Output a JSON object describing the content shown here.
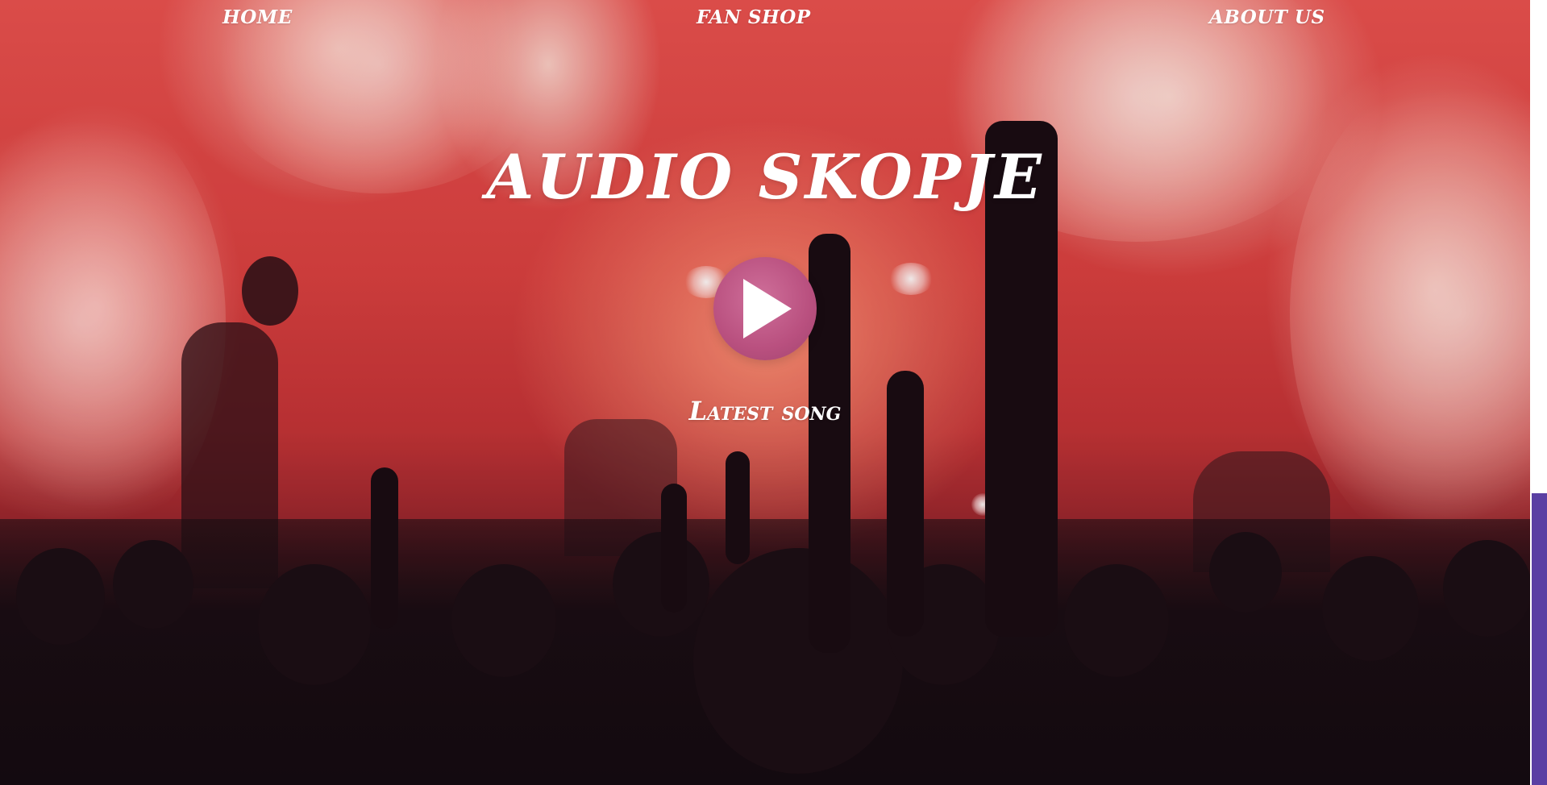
{
  "nav": {
    "home": "HOME",
    "fan_shop": "FAN SHOP",
    "about_us": "ABOUT US"
  },
  "hero": {
    "title": "AUDIO SKOPJE",
    "latest_song_label": "Latest song",
    "play_icon": "play-icon"
  },
  "colors": {
    "play_button": "#b9507f",
    "side_accent": "#5a3fa3",
    "text": "#ffffff"
  }
}
